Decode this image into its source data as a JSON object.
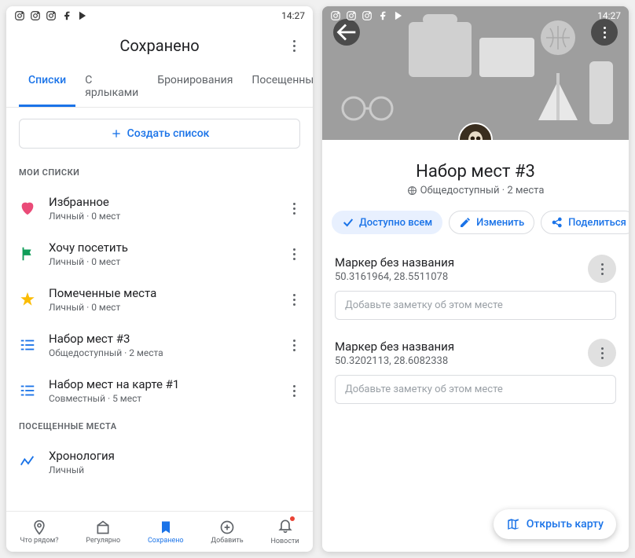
{
  "status": {
    "time": "14:27"
  },
  "phone1": {
    "title": "Сохранено",
    "tabs": [
      "Списки",
      "С ярлыками",
      "Бронирования",
      "Посещенные"
    ],
    "create": "Создать список",
    "section1": "МОИ СПИСКИ",
    "lists": [
      {
        "title": "Избранное",
        "sub": "Личный · 0 мест"
      },
      {
        "title": "Хочу посетить",
        "sub": "Личный · 0 мест"
      },
      {
        "title": "Помеченные места",
        "sub": "Личный · 0 мест"
      },
      {
        "title": "Набор мест #3",
        "sub": "Общедоступный · 2 места"
      },
      {
        "title": "Набор мест на карте #1",
        "sub": "Совместный · 5 мест"
      }
    ],
    "section2": "ПОСЕЩЕННЫЕ МЕСТА",
    "timeline": {
      "title": "Хронология",
      "sub": "Личный"
    },
    "nav": [
      "Что рядом?",
      "Регулярно",
      "Сохранено",
      "Добавить",
      "Новости"
    ]
  },
  "phone2": {
    "title": "Набор мест #3",
    "sub": "Общедоступный · 2 места",
    "chips": {
      "public": "Доступно всем",
      "edit": "Изменить",
      "share": "Поделиться"
    },
    "places": [
      {
        "title": "Маркер без названия",
        "coords": "50.3161964, 28.5511078"
      },
      {
        "title": "Маркер без названия",
        "coords": "50.3202113, 28.6082338"
      }
    ],
    "note_placeholder": "Добавьте заметку об этом месте",
    "fab": "Открыть карту"
  }
}
